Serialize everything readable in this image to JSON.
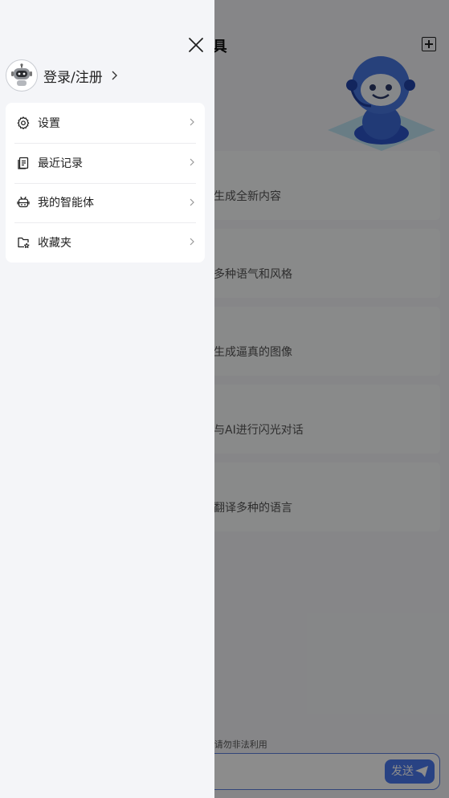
{
  "background": {
    "title": "AI工具",
    "cards": [
      "生成全新内容",
      "多种语气和风格",
      "生成逼真的图像",
      "与AI进行闪光对话",
      "翻译多种的语言"
    ],
    "notice": "内容由AI生成！请勿非法利用",
    "send_label": "发送"
  },
  "drawer": {
    "login_label": "登录/注册",
    "menu": [
      {
        "label": "设置",
        "icon": "gear-icon"
      },
      {
        "label": "最近记录",
        "icon": "document-icon"
      },
      {
        "label": "我的智能体",
        "icon": "robot-icon"
      },
      {
        "label": "收藏夹",
        "icon": "folder-star-icon"
      }
    ]
  },
  "colors": {
    "accent": "#4a78ee",
    "drawer_bg": "#f4f5f8",
    "card_bg": "#ffffff",
    "overlay": "rgba(0,0,0,0.45)"
  }
}
